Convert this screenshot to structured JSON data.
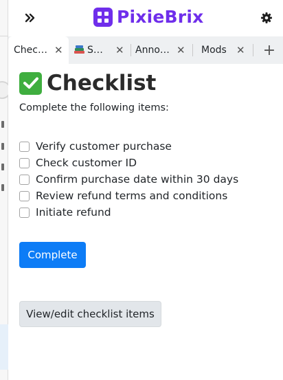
{
  "header": {
    "brand_name": "PixieBrix",
    "brand_color": "#6f2eeb"
  },
  "tabs": [
    {
      "label": "Chec…",
      "active": true
    },
    {
      "label": "S…",
      "icon": "books-icon",
      "active": false
    },
    {
      "label": "Anno…",
      "active": false
    },
    {
      "label": "Mods",
      "active": false
    }
  ],
  "close_glyph": "✕",
  "add_tab_glyph": "+",
  "checklist": {
    "title": "Checklist",
    "subtitle": "Complete the following items:",
    "items": [
      {
        "label": "Verify customer purchase",
        "checked": false
      },
      {
        "label": "Check customer ID",
        "checked": false
      },
      {
        "label": "Confirm purchase date within 30 days",
        "checked": false
      },
      {
        "label": "Review refund terms and conditions",
        "checked": false
      },
      {
        "label": "Initiate refund",
        "checked": false
      }
    ],
    "complete_label": "Complete",
    "edit_label": "View/edit checklist items"
  },
  "colors": {
    "primary": "#0d7cf6",
    "secondary": "#e2e6ea",
    "check_green": "#3fae3f"
  }
}
